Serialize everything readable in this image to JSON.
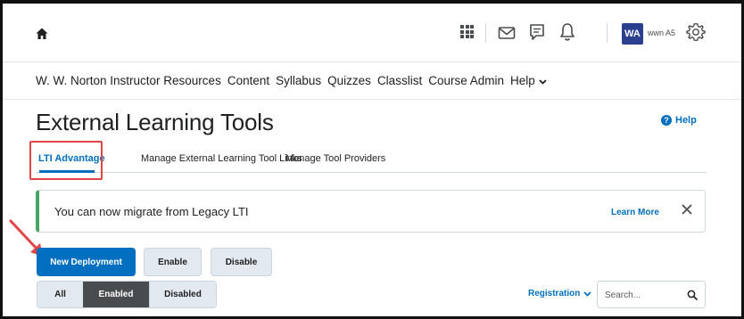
{
  "topbar": {
    "avatar_initials": "WA",
    "user_name": "wwn A5"
  },
  "nav": {
    "items": [
      {
        "label": "W. W. Norton Instructor Resources"
      },
      {
        "label": "Content"
      },
      {
        "label": "Syllabus"
      },
      {
        "label": "Quizzes"
      },
      {
        "label": "Classlist"
      },
      {
        "label": "Course Admin"
      },
      {
        "label": "Help"
      }
    ]
  },
  "page": {
    "title": "External Learning Tools",
    "help_label": "Help",
    "help_glyph": "?"
  },
  "tabs": [
    {
      "label": "LTI Advantage",
      "active": true
    },
    {
      "label": "Manage External Learning Tool Links",
      "active": false
    },
    {
      "label": "Manage Tool Providers",
      "active": false
    }
  ],
  "alert": {
    "message": "You can now migrate from Legacy LTI",
    "learn_more": "Learn More",
    "accent_color": "#46a661"
  },
  "actions": {
    "new_deployment": "New Deployment",
    "enable": "Enable",
    "disable": "Disable"
  },
  "filter": {
    "all": "All",
    "enabled": "Enabled",
    "disabled": "Disabled",
    "selected": "Enabled"
  },
  "registration": {
    "label": "Registration"
  },
  "search": {
    "placeholder": "Search..."
  },
  "colors": {
    "primary": "#006fbf",
    "annotation_red": "#e04646",
    "avatar_bg": "#2b3f8f"
  }
}
